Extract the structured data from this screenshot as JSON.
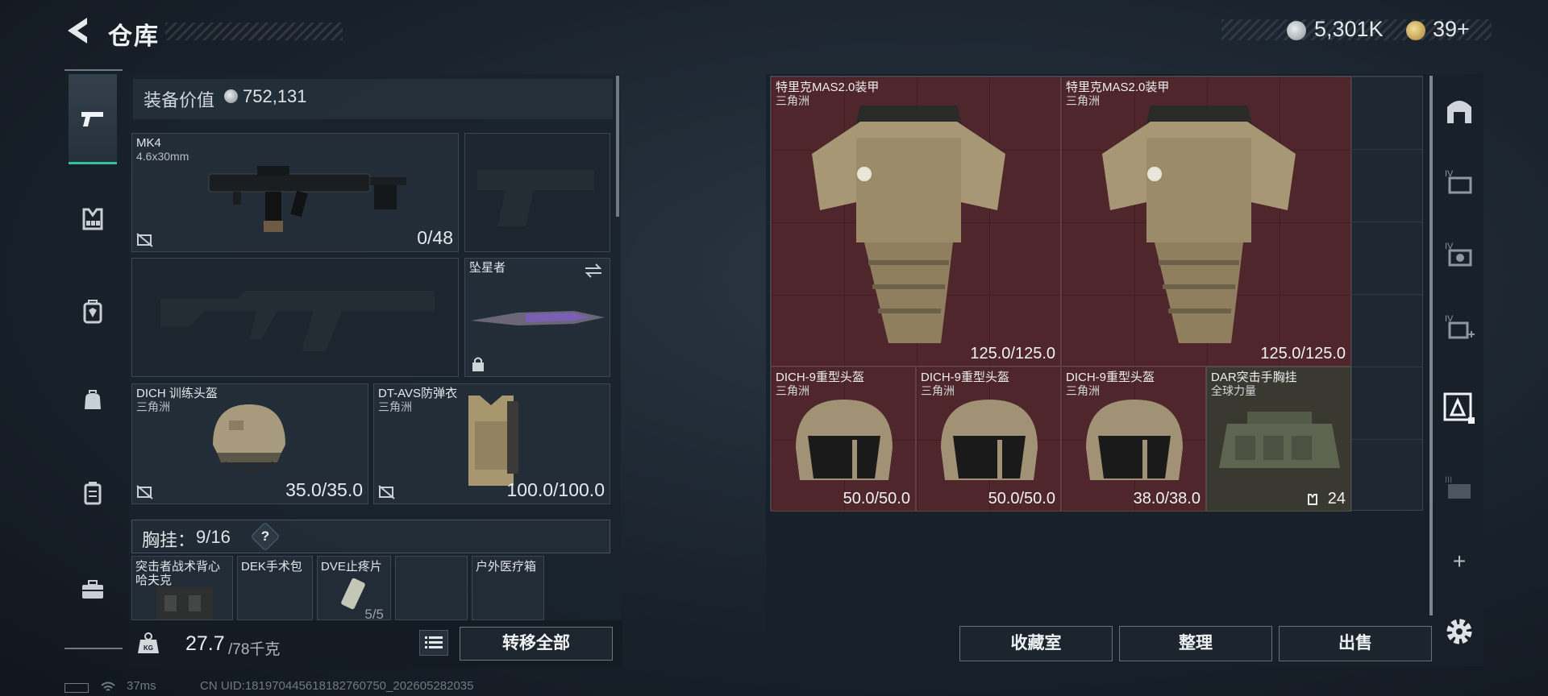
{
  "header": {
    "title": "仓库",
    "money": "5,301K",
    "tickets": "39+",
    "back_icon": "back-arrow-icon",
    "currency_colors": {
      "money": "#c8d0d6",
      "tickets": "#d6b55a"
    }
  },
  "rail": {
    "tabs": [
      {
        "icon": "pistol-icon",
        "active": true
      },
      {
        "icon": "chest-rig-icon",
        "active": false
      },
      {
        "icon": "backpack-icon",
        "active": false
      },
      {
        "icon": "bag-icon",
        "active": false
      },
      {
        "icon": "case-icon",
        "active": false
      },
      {
        "icon": "toolbox-icon",
        "active": false
      }
    ]
  },
  "loadout": {
    "value_label": "装备价值",
    "value": "752,131",
    "primary_weapon": {
      "name": "MK4",
      "caliber": "4.6x30mm",
      "ammo": "0/48"
    },
    "melee": {
      "name": "坠星者"
    },
    "helmet": {
      "name": "DICH 训练头盔",
      "source": "三角洲",
      "durability": "35.0/35.0"
    },
    "armor": {
      "name": "DT-AVS防弹衣",
      "source": "三角洲",
      "durability": "100.0/100.0"
    },
    "chest_rig": {
      "label": "胸挂：",
      "count": "9/16",
      "help": "?"
    },
    "pockets": [
      {
        "name": "突击者战术背心\n哈夫克",
        "count": ""
      },
      {
        "name": "DEK手术包",
        "count": ""
      },
      {
        "name": "DVE止疼片",
        "count": "5/5"
      },
      {
        "name": "",
        "count": ""
      },
      {
        "name": "户外医疗箱",
        "count": ""
      }
    ],
    "weight_current": "27.7",
    "weight_max": "/78千克",
    "transfer_all": "转移全部"
  },
  "stash": {
    "items": [
      {
        "name": "特里克MAS2.0装甲",
        "source": "三角洲",
        "durability": "125.0/125.0"
      },
      {
        "name": "特里克MAS2.0装甲",
        "source": "三角洲",
        "durability": "125.0/125.0"
      },
      {
        "name": "DICH-9重型头盔",
        "source": "三角洲",
        "durability": "50.0/50.0"
      },
      {
        "name": "DICH-9重型头盔",
        "source": "三角洲",
        "durability": "50.0/50.0"
      },
      {
        "name": "DICH-9重型头盔",
        "source": "三角洲",
        "durability": "38.0/38.0"
      },
      {
        "name": "DAR突击手胸挂",
        "source": "全球力量",
        "durability": "24"
      }
    ],
    "buttons": {
      "collection": "收藏室",
      "sort": "整理",
      "sell": "出售"
    },
    "side_tabs": [
      {
        "label": "",
        "icon": "storage-home-icon"
      },
      {
        "label": "IV",
        "icon": "stash-case-icon"
      },
      {
        "label": "IV",
        "icon": "stash-camera-icon"
      },
      {
        "label": "IV",
        "icon": "stash-medical-icon"
      },
      {
        "label": "",
        "icon": "stash-armor-icon",
        "active": true
      },
      {
        "label": "III",
        "icon": "stash-locked-icon"
      },
      {
        "label": "+",
        "icon": "add-icon"
      }
    ]
  },
  "status": {
    "ping": "37ms",
    "uid": "CN UID:18197044561818276075​0_202605282035"
  }
}
